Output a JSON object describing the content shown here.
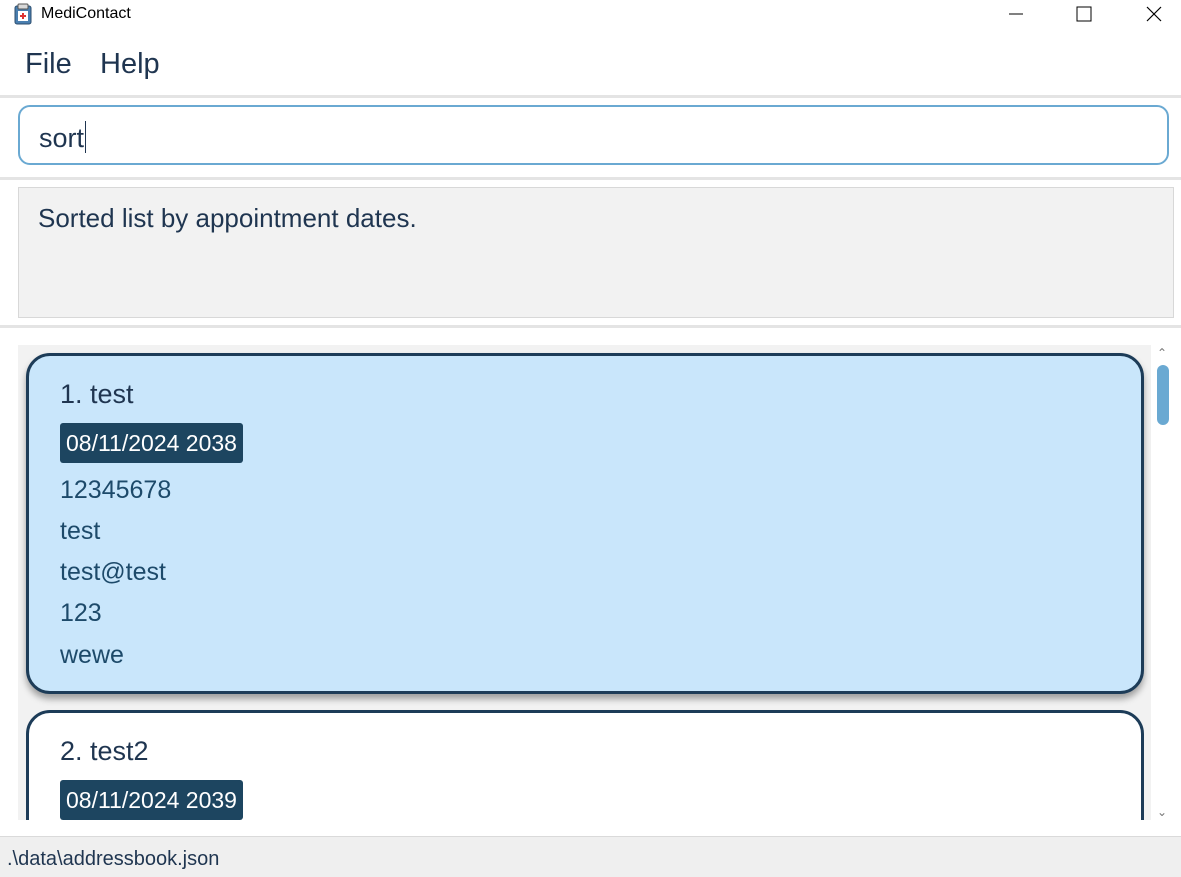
{
  "window": {
    "title": "MediContact",
    "icon": "app-clipboard-icon",
    "controls": [
      "minimize-icon",
      "maximize-icon",
      "close-icon"
    ]
  },
  "menu": {
    "file": "File",
    "help": "Help"
  },
  "command": {
    "value": "sort"
  },
  "result": {
    "message": "Sorted list by appointment dates."
  },
  "contacts": [
    {
      "index_name": "1. test",
      "appointment": "08/11/2024 2038",
      "phone": "12345678",
      "field2": "test",
      "email": "test@test",
      "field4": "123",
      "field5": "wewe",
      "selected": true
    },
    {
      "index_name": "2. test2",
      "appointment": "08/11/2024 2039",
      "selected": false
    }
  ],
  "status": {
    "path": ".\\data\\addressbook.json"
  },
  "colors": {
    "accent": "#6aa9d2",
    "selected_card": "#c9e6fb",
    "card_border": "#1d3c58",
    "tag_bg": "#1d4560"
  }
}
